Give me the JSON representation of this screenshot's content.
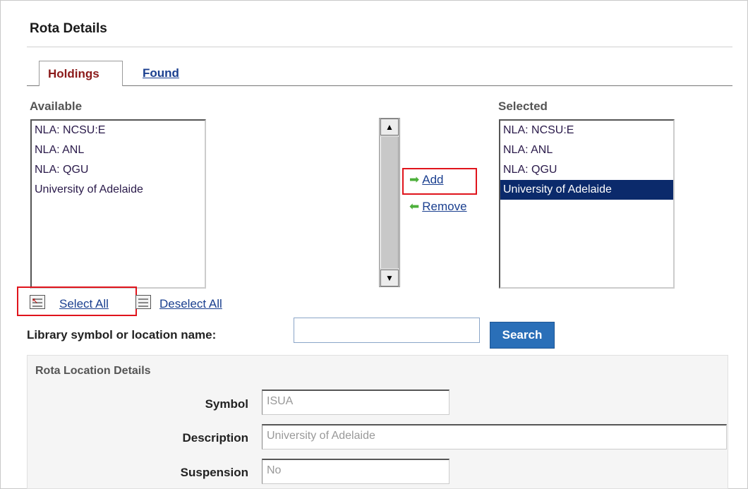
{
  "page": {
    "title": "Rota Details"
  },
  "tabs": {
    "holdings": "Holdings",
    "found": "Found"
  },
  "available": {
    "heading": "Available",
    "items": [
      "NLA: NCSU:E",
      "NLA: ANL",
      "NLA: QGU",
      "University of Adelaide"
    ]
  },
  "selected": {
    "heading": "Selected",
    "items": [
      "NLA: NCSU:E",
      "NLA: ANL",
      "NLA: QGU",
      "University of Adelaide"
    ],
    "highlighted_index": 3
  },
  "actions": {
    "add": "Add",
    "remove": "Remove"
  },
  "selection": {
    "select_all": "Select All",
    "deselect_all": "Deselect All"
  },
  "search": {
    "label": "Library symbol or location name:",
    "value": "",
    "button": "Search"
  },
  "details": {
    "title": "Rota Location Details",
    "symbol_label": "Symbol",
    "symbol_value": "ISUA",
    "description_label": "Description",
    "description_value": "University of Adelaide",
    "suspension_label": "Suspension",
    "suspension_value": "No"
  },
  "colors": {
    "highlight": "#0b2a6b",
    "search_button": "#2a6fb8",
    "callout": "#e0141c",
    "link": "#1a3f8f"
  },
  "icons": {
    "add": "arrow-right-icon",
    "remove": "arrow-left-icon",
    "select_all": "select-all-icon",
    "deselect_all": "deselect-all-icon"
  }
}
